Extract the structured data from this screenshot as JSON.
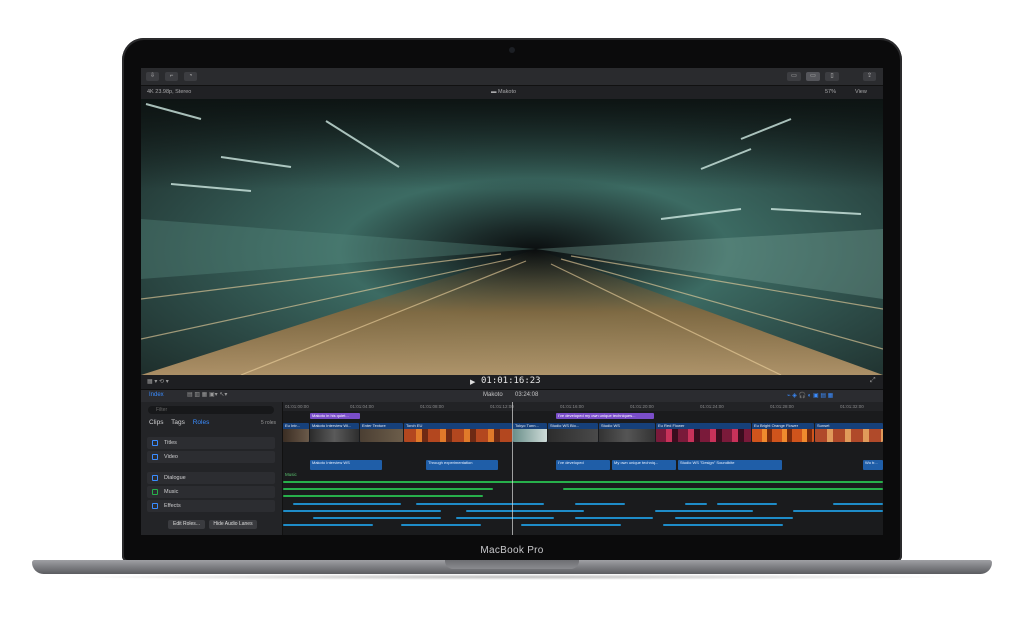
{
  "device": {
    "brand": "MacBook Pro"
  },
  "colors": {
    "accent": "#3a8cff",
    "video_clip": "#16407a",
    "audio_clip": "#1f5ea8",
    "title_clip": "#7a4ec9",
    "music": "#27b04b",
    "effects": "#1e8cc8"
  },
  "infobar": {
    "format": "4K 23.98p, Stereo",
    "project": "Makoto",
    "zoom": "57%",
    "view": "View"
  },
  "transport": {
    "timecode": "01:01:16:23"
  },
  "timeline_header": {
    "index_label": "Index",
    "project": "Makoto",
    "duration": "03:24:08"
  },
  "index": {
    "search_placeholder": "Filter",
    "tabs": [
      "Clips",
      "Tags",
      "Roles"
    ],
    "count": "5 roles",
    "roles": [
      {
        "name": "Titles"
      },
      {
        "name": "Video"
      },
      {
        "name": "Dialogue"
      },
      {
        "name": "Music"
      },
      {
        "name": "Effects"
      }
    ],
    "buttons": {
      "edit_roles": "Edit Roles...",
      "hide_audio_lanes": "Hide Audio Lanes"
    }
  },
  "ruler": [
    "01:01:00:00",
    "01:01:04:00",
    "01:01:08:00",
    "01:01:12:00",
    "01:01:16:00",
    "01:01:20:00",
    "01:01:24:00",
    "01:01:28:00",
    "01:01:32:00",
    "01:01:36:00"
  ],
  "title_clips": [
    "Makoto in his quiet...",
    "I've developed my own unique techniques..."
  ],
  "video_clips": [
    "Eu Intr...",
    "Makoto Interview Wi...",
    "Enter Texture",
    "Torch EU",
    "Tokyo Tunn...",
    "Studio WS Blo...",
    "Studio WS",
    "Eu Red Flower",
    "Eu Bright Orange Flower",
    "Sunset"
  ],
  "audio_clips": [
    "Makoto Interview WS",
    "Through experimentation",
    "I've developed",
    "My own unique techniq...",
    "Studio WS \"Design\" Soundbite",
    "Wo tr..."
  ],
  "music_label": "Music"
}
